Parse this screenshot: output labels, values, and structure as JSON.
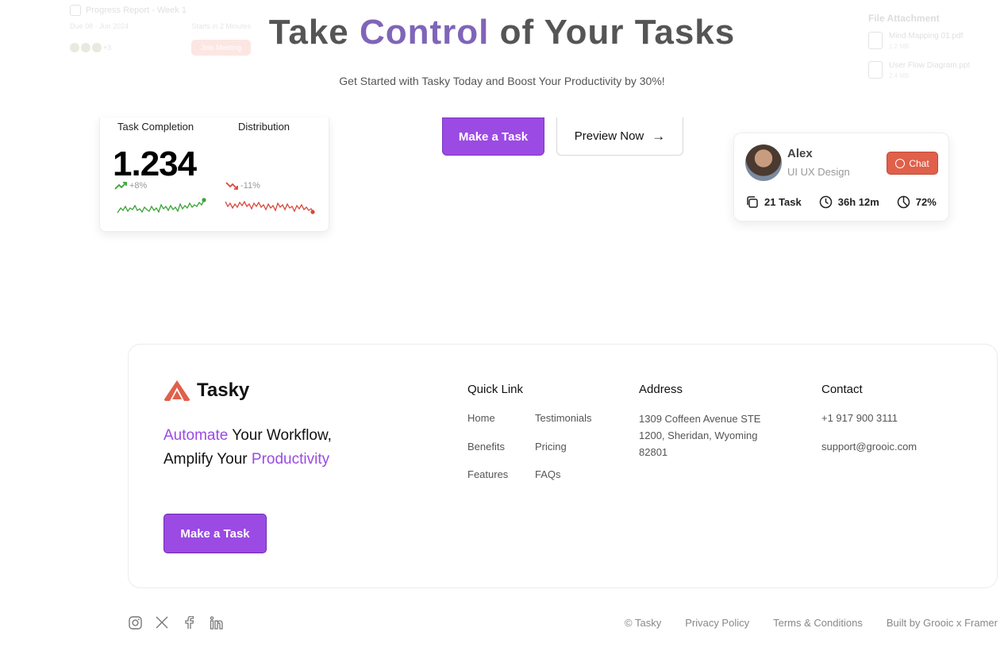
{
  "ghost_left": {
    "title": "Progress Report - Week 1",
    "meta_left": "Due 08 · Jun 2024",
    "meta_right": "Starts in 2 Minutes",
    "avatars_more": "+3",
    "pill": "Join Meeting"
  },
  "ghost_right": {
    "title": "File Attachment",
    "files": [
      {
        "name": "Mind Mapping 01.pdf",
        "size": "1.2 MB"
      },
      {
        "name": "User Flow Diagram.ppt",
        "size": "2.4 MB"
      }
    ]
  },
  "hero": {
    "title_before": "Take ",
    "title_accent": "Control",
    "title_after": " of Your Tasks",
    "subtitle": "Get Started with Tasky Today and Boost Your Productivity by 30%!",
    "primary_cta": "Make a Task",
    "secondary_cta": "Preview Now"
  },
  "stats": {
    "label_completion": "Task Completion",
    "label_distribution": "Distribution",
    "value": "1.234",
    "up_change": "+8%",
    "down_change": "-11%",
    "up_color": "#3aa335",
    "down_color": "#d8483a"
  },
  "profile": {
    "name": "Alex",
    "role": "UI UX Design",
    "chat_label": "Chat",
    "tasks": "21 Task",
    "time": "36h 12m",
    "percent": "72%"
  },
  "footer": {
    "brand": "Tasky",
    "tagline_accent1": "Automate",
    "tagline_mid": " Your Workflow, Amplify Your ",
    "tagline_accent2": "Productivity",
    "cta": "Make a Task",
    "quick_link_title": "Quick Link",
    "links_col1": [
      "Home",
      "Benefits",
      "Features"
    ],
    "links_col2": [
      "Testimonials",
      "Pricing",
      "FAQs"
    ],
    "address_title": "Address",
    "address": "1309 Coffeen Avenue STE 1200, Sheridan, Wyoming 82801",
    "contact_title": "Contact",
    "phone": "+1 917 900 3111",
    "email": "support@grooic.com"
  },
  "bottom": {
    "copyright": "© Tasky",
    "privacy": "Privacy Policy",
    "terms": "Terms & Conditions",
    "built": "Built by Grooic x Framer",
    "socials": [
      "instagram-icon",
      "x-icon",
      "facebook-icon",
      "linkedin-icon"
    ]
  },
  "colors": {
    "accent_purple": "#9b4ae3",
    "brand_orange": "#e0604a"
  }
}
